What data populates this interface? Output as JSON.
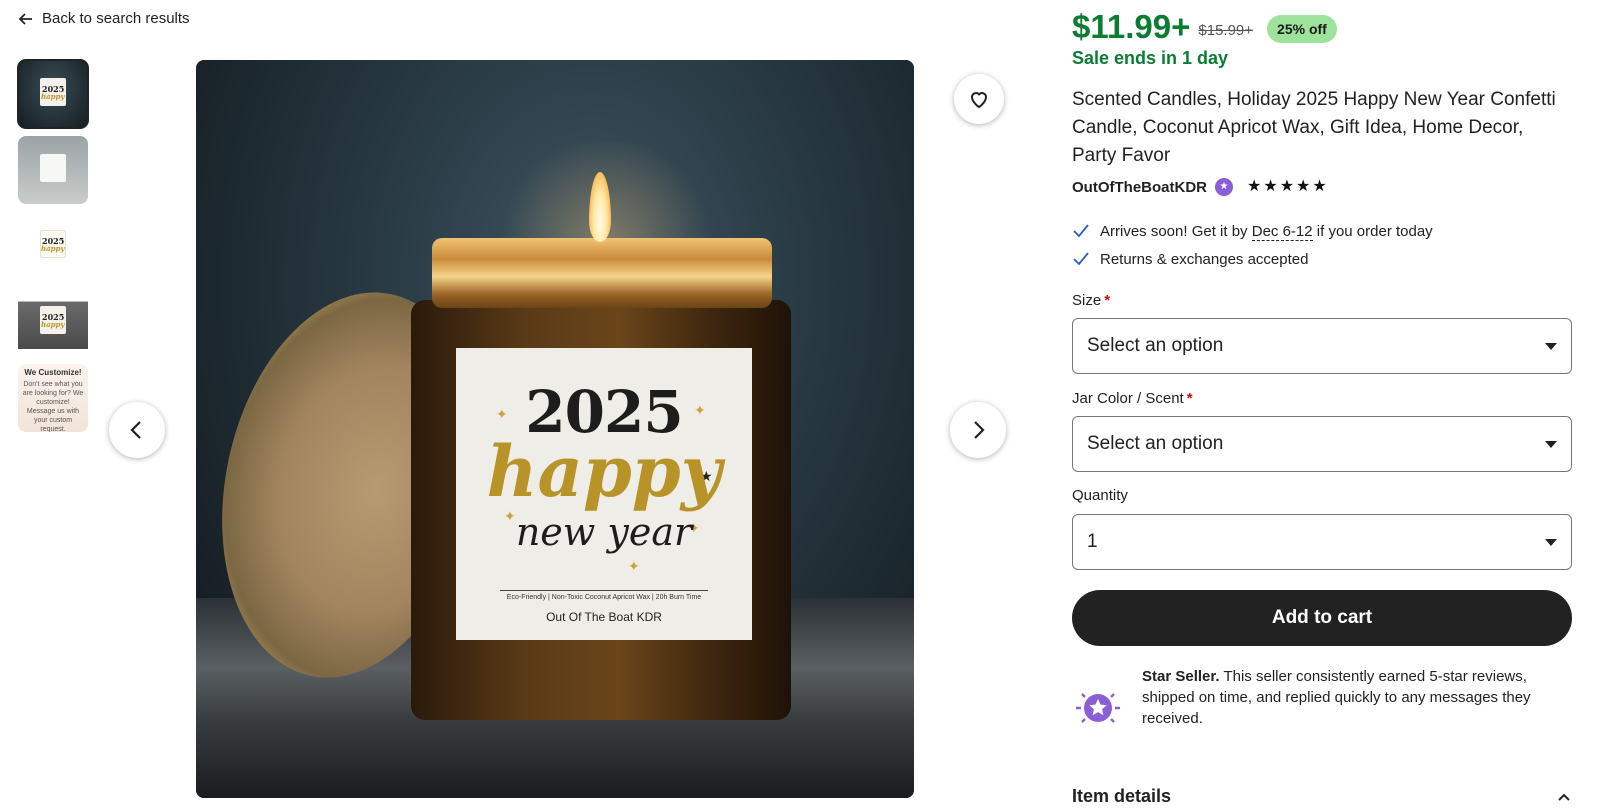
{
  "nav": {
    "back_label": "Back to search results"
  },
  "gallery": {
    "thumb_custom_title": "We Customize!",
    "thumb_custom_body": "Don't see what you are looking for? We customize! Message us with your custom request.",
    "thumb_year": "2025",
    "thumb_happy": "happy"
  },
  "candle_label": {
    "year": "2025",
    "happy": "happy",
    "new_year": "new year",
    "fine_print": "Eco-Friendly | Non-Toxic Coconut Apricot Wax | 20h Burn Time",
    "brand": "Out Of The Boat KDR"
  },
  "product": {
    "price": "$11.99+",
    "original_price": "$15.99+",
    "discount": "25% off",
    "sale_ends": "Sale ends in 1 day",
    "title": "Scented Candles, Holiday 2025 Happy New Year Confetti Candle, Coconut Apricot Wax, Gift Idea, Home Decor, Party Favor",
    "shop_name": "OutOfTheBoatKDR",
    "rating": 5
  },
  "perks": {
    "arrives_prefix": "Arrives soon! Get it by",
    "arrives_date": "Dec 6-12",
    "arrives_suffix": "if you order today",
    "returns": "Returns & exchanges accepted"
  },
  "form": {
    "size_label": "Size",
    "size_value": "Select an option",
    "jar_label": "Jar Color / Scent",
    "jar_value": "Select an option",
    "quantity_label": "Quantity",
    "quantity_value": "1",
    "required_mark": "*"
  },
  "cart": {
    "label": "Add to cart"
  },
  "star_seller": {
    "title": "Star Seller.",
    "body": "This seller consistently earned 5-star reviews, shipped on time, and replied quickly to any messages they received."
  },
  "details": {
    "label": "Item details"
  },
  "colors": {
    "price_green": "#0a7d33",
    "discount_bg": "#9ee39b",
    "cart_bg": "#222222",
    "star_seller_purple": "#8a5fd6",
    "check_blue": "#2d5fc4"
  }
}
